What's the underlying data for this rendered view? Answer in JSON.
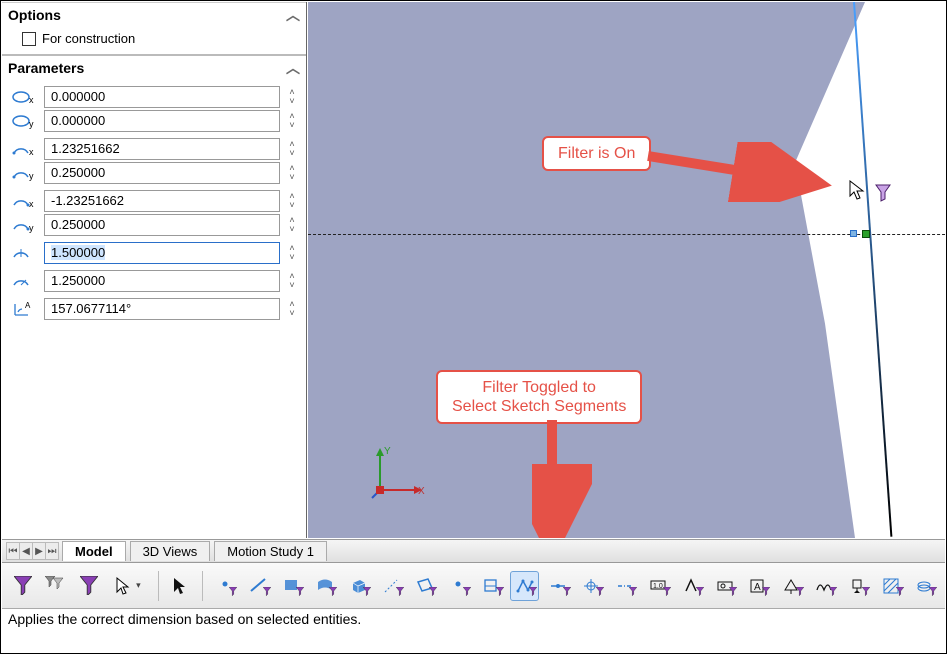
{
  "panel": {
    "options_header": "Options",
    "for_construction_label": "For construction",
    "for_construction_checked": false,
    "parameters_header": "Parameters",
    "groups": [
      {
        "rows": [
          {
            "icon": "param-cx",
            "value": "0.000000"
          },
          {
            "icon": "param-cy",
            "value": "0.000000"
          }
        ]
      },
      {
        "rows": [
          {
            "icon": "param-ax",
            "value": "1.23251662"
          },
          {
            "icon": "param-ay",
            "value": "0.250000"
          }
        ]
      },
      {
        "rows": [
          {
            "icon": "param-bx",
            "value": "-1.23251662"
          },
          {
            "icon": "param-by",
            "value": "0.250000"
          }
        ]
      },
      {
        "rows": [
          {
            "icon": "param-radius-major",
            "value": "1.500000",
            "active": true
          }
        ]
      },
      {
        "rows": [
          {
            "icon": "param-radius-minor",
            "value": "1.250000"
          }
        ]
      },
      {
        "rows": [
          {
            "icon": "param-angle",
            "value": "157.0677114°"
          }
        ]
      }
    ]
  },
  "viewport": {
    "triad": {
      "x_label": "X",
      "y_label": "Y"
    },
    "filter_icon": "filter-icon"
  },
  "callouts": {
    "filter_on": "Filter is On",
    "filter_toggle_line1": "Filter Toggled to",
    "filter_toggle_line2": "Select Sketch Segments"
  },
  "tabs": {
    "items": [
      {
        "label": "Model",
        "active": true
      },
      {
        "label": "3D Views",
        "active": false
      },
      {
        "label": "Motion Study 1",
        "active": false
      }
    ]
  },
  "toolbar": {
    "buttons": [
      {
        "name": "selection-filter-toggle-icon",
        "color": "#8a3fb5",
        "funnel": true
      },
      {
        "name": "clear-filters-icon",
        "color": "#555",
        "funnel": true
      },
      {
        "name": "select-all-filters-icon",
        "color": "#8a3fb5",
        "funnel": true
      },
      {
        "name": "cursor-select-icon",
        "dropdown": true
      },
      {
        "sep": true
      },
      {
        "name": "invert-selection-icon",
        "color": "#111"
      },
      {
        "sep": true
      },
      {
        "name": "filter-vertices-icon",
        "shape": "dot",
        "color": "#2e7bd1",
        "funnel": true
      },
      {
        "name": "filter-edges-icon",
        "shape": "line",
        "color": "#2e7bd1",
        "funnel": true
      },
      {
        "name": "filter-faces-icon",
        "shape": "box",
        "color": "#2e7bd1",
        "funnel": true
      },
      {
        "name": "filter-surface-bodies-icon",
        "shape": "surf",
        "color": "#2e7bd1",
        "funnel": true
      },
      {
        "name": "filter-solid-bodies-icon",
        "shape": "cube",
        "color": "#2e7bd1",
        "funnel": true
      },
      {
        "name": "filter-axes-icon",
        "shape": "axis",
        "color": "#2e7bd1",
        "funnel": true
      },
      {
        "name": "filter-planes-icon",
        "shape": "plane",
        "color": "#2e7bd1",
        "funnel": true
      },
      {
        "name": "filter-sketch-points-icon",
        "shape": "dot",
        "color": "#2e7bd1",
        "funnel": true
      },
      {
        "name": "filter-sketches-icon",
        "shape": "sketch",
        "color": "#2e7bd1",
        "funnel": true
      },
      {
        "name": "filter-sketch-segments-icon",
        "shape": "segments",
        "color": "#2e7bd1",
        "funnel": true,
        "active": true
      },
      {
        "name": "filter-midpoints-icon",
        "shape": "mid",
        "color": "#2e7bd1",
        "funnel": true
      },
      {
        "name": "filter-center-marks-icon",
        "shape": "center",
        "color": "#2e7bd1",
        "funnel": true
      },
      {
        "name": "filter-centerlines-icon",
        "shape": "cl",
        "color": "#2e7bd1",
        "funnel": true
      },
      {
        "name": "filter-dimensions-icon",
        "shape": "dim",
        "color": "#111",
        "funnel": true
      },
      {
        "name": "filter-surface-finish-icon",
        "shape": "sf",
        "color": "#111",
        "funnel": true
      },
      {
        "name": "filter-geometric-tolerance-icon",
        "shape": "gtol",
        "color": "#111",
        "funnel": true
      },
      {
        "name": "filter-notes-icon",
        "shape": "note",
        "color": "#111",
        "funnel": true
      },
      {
        "name": "filter-annotations-icon",
        "shape": "annot",
        "color": "#111",
        "funnel": true
      },
      {
        "name": "filter-weld-beads-icon",
        "shape": "weld",
        "color": "#111",
        "funnel": true
      },
      {
        "name": "filter-datum-icon",
        "shape": "datum",
        "color": "#111",
        "funnel": true
      },
      {
        "name": "filter-hatches-icon",
        "shape": "hatch",
        "color": "#2e7bd1",
        "funnel": true
      },
      {
        "name": "filter-cosmetic-threads-icon",
        "shape": "thread",
        "color": "#2e7bd1",
        "funnel": true
      }
    ]
  },
  "status_text": "Applies the correct dimension based on selected entities."
}
